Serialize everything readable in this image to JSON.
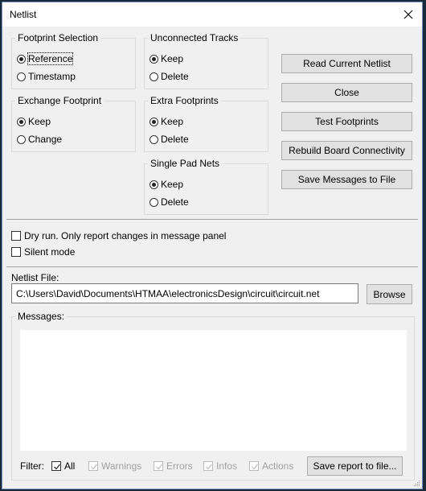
{
  "window": {
    "title": "Netlist"
  },
  "footprint_selection": {
    "label": "Footprint Selection",
    "options": [
      {
        "label": "Reference",
        "selected": true
      },
      {
        "label": "Timestamp",
        "selected": false
      }
    ]
  },
  "unconnected_tracks": {
    "label": "Unconnected Tracks",
    "options": [
      {
        "label": "Keep",
        "selected": true
      },
      {
        "label": "Delete",
        "selected": false
      }
    ]
  },
  "exchange_footprint": {
    "label": "Exchange Footprint",
    "options": [
      {
        "label": "Keep",
        "selected": true
      },
      {
        "label": "Change",
        "selected": false
      }
    ]
  },
  "extra_footprints": {
    "label": "Extra Footprints",
    "options": [
      {
        "label": "Keep",
        "selected": true
      },
      {
        "label": "Delete",
        "selected": false
      }
    ]
  },
  "single_pad_nets": {
    "label": "Single Pad Nets",
    "options": [
      {
        "label": "Keep",
        "selected": true
      },
      {
        "label": "Delete",
        "selected": false
      }
    ]
  },
  "buttons": {
    "read_netlist": "Read Current Netlist",
    "close": "Close",
    "test_footprints": "Test Footprints",
    "rebuild_connectivity": "Rebuild Board Connectivity",
    "save_messages": "Save Messages to File"
  },
  "options": {
    "dry_run": {
      "label": "Dry run. Only report changes in message panel",
      "checked": false
    },
    "silent_mode": {
      "label": "Silent mode",
      "checked": false
    }
  },
  "netlist_file": {
    "label": "Netlist File:",
    "value": "C:\\Users\\David\\Documents\\HTMAA\\electronicsDesign\\circuit\\circuit.net",
    "browse_label": "Browse"
  },
  "messages": {
    "label": "Messages:",
    "content": "",
    "filter_label": "Filter:",
    "filters": [
      {
        "label": "All",
        "checked": true,
        "enabled": true
      },
      {
        "label": "Warnings",
        "checked": true,
        "enabled": false
      },
      {
        "label": "Errors",
        "checked": true,
        "enabled": false
      },
      {
        "label": "Infos",
        "checked": true,
        "enabled": false
      },
      {
        "label": "Actions",
        "checked": true,
        "enabled": false
      }
    ],
    "save_report_label": "Save report to file..."
  }
}
